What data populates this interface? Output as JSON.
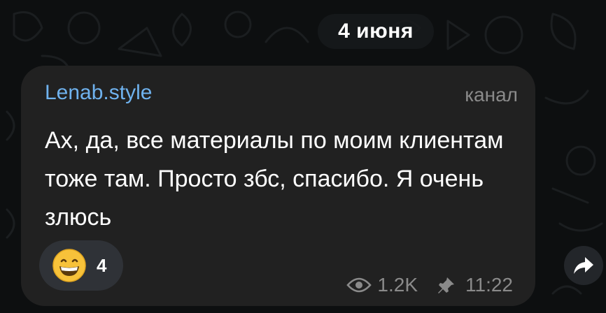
{
  "date_separator": "4 июня",
  "post": {
    "sender": "Lenab.style",
    "badge": "канал",
    "text": "Ах, да, все материалы по моим клиентам тоже там. Просто збс, спасибо. Я очень злюсь",
    "reaction": {
      "emoji": "grinning-face",
      "count": "4"
    },
    "views": "1.2K",
    "time": "11:22"
  },
  "colors": {
    "background": "#0d0f10",
    "bubble": "#212121",
    "sender": "#6fb2ee",
    "muted": "#8a8a8a"
  },
  "icons": {
    "views": "eye-icon",
    "pinned": "pin-icon",
    "share": "share-arrow-icon"
  }
}
